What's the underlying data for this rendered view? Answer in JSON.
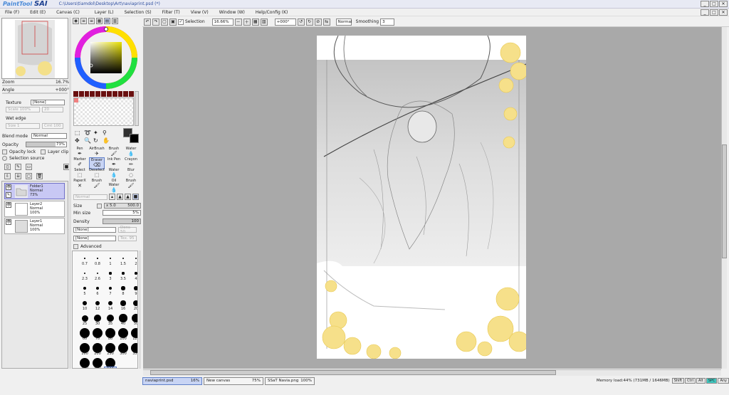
{
  "app": {
    "logo_small": "PaintTool",
    "logo_big": "SAI",
    "path": "C:\\Users\\tiamdol\\Desktop\\Art\\naviaprint.psd (*)"
  },
  "menu": [
    "File (F)",
    "Edit (E)",
    "Canvas (C)",
    "Layer (L)",
    "Selection (S)",
    "Filter (T)",
    "View (V)",
    "Window (W)",
    "Help/Config (K)"
  ],
  "navigator": {
    "zoom_label": "Zoom",
    "zoom_value": "16.7%",
    "angle_label": "Angle",
    "angle_value": "+000°"
  },
  "layer_props": {
    "texture_label": "Texture",
    "texture_value": "[None]",
    "scale_label": "Scale",
    "scale_value": "100%",
    "scale_num": "20",
    "wet_edge_label": "Wet edge",
    "size_label": "Size",
    "size_value": "1",
    "size_extra": "Cmt 100",
    "blend_label": "Blend mode",
    "blend_value": "Normal",
    "opacity_label": "Opacity",
    "opacity_value": "73%",
    "opacity_lock": "Opacity lock",
    "layer_clip": "Layer clip",
    "selection_source": "Selection source"
  },
  "layers": [
    {
      "name": "Folder1",
      "mode": "Normal",
      "opacity": "73%"
    },
    {
      "name": "Layer2",
      "mode": "Normal",
      "opacity": "100%"
    },
    {
      "name": "Layer1",
      "mode": "Normal",
      "opacity": "100%"
    }
  ],
  "tools": [
    [
      "Pen",
      "AirBrush",
      "Brush",
      "Water"
    ],
    [
      "Marker",
      "Eraser",
      "Ink Pen",
      "Crayon"
    ],
    [
      "Select",
      "Deselect",
      "Water",
      "Blur"
    ],
    [
      "PaperX",
      "Brush",
      "Oil Water",
      "Brush"
    ]
  ],
  "brush": {
    "mode": "Normal",
    "size_label": "Size",
    "size_mult": "x 5.0",
    "size_value": "500.0",
    "minsize_label": "Min size",
    "minsize_value": "5%",
    "density_label": "Density",
    "density_value": "100",
    "tex1": "[None]",
    "tex1_num": "Dens 50",
    "tex2": "[None]",
    "tex2_num": "Tex. 95",
    "advanced": "Advanced"
  },
  "brush_sizes": [
    "0.7",
    "0.8",
    "1",
    "1.5",
    "2",
    "2.3",
    "2.6",
    "3",
    "3.5",
    "4",
    "5",
    "6",
    "7",
    "8",
    "9",
    "10",
    "12",
    "14",
    "16",
    "20",
    "25",
    "30",
    "35",
    "40",
    "50",
    "60",
    "70",
    "80",
    "100",
    "120",
    "160",
    "200",
    "250",
    "300",
    "350",
    "400",
    "450",
    "500"
  ],
  "canvas_toolbar": {
    "selection": "Selection",
    "zoom": "16.66%",
    "angle": "+000°",
    "mode": "Normal",
    "smoothing_label": "Smoothing",
    "smoothing_value": "3"
  },
  "tabs": [
    {
      "name": "naviaprint.psd",
      "pct": "16%",
      "active": true
    },
    {
      "name": "New canvas",
      "pct": "75%",
      "active": false
    },
    {
      "name": "SSaT Navia.png",
      "pct": "100%",
      "active": false
    }
  ],
  "status": {
    "memory": "Memory load:44% (731MB / 1646MB)",
    "keys": [
      "Shift",
      "Ctrl",
      "Alt",
      "SPC",
      "Any"
    ]
  }
}
